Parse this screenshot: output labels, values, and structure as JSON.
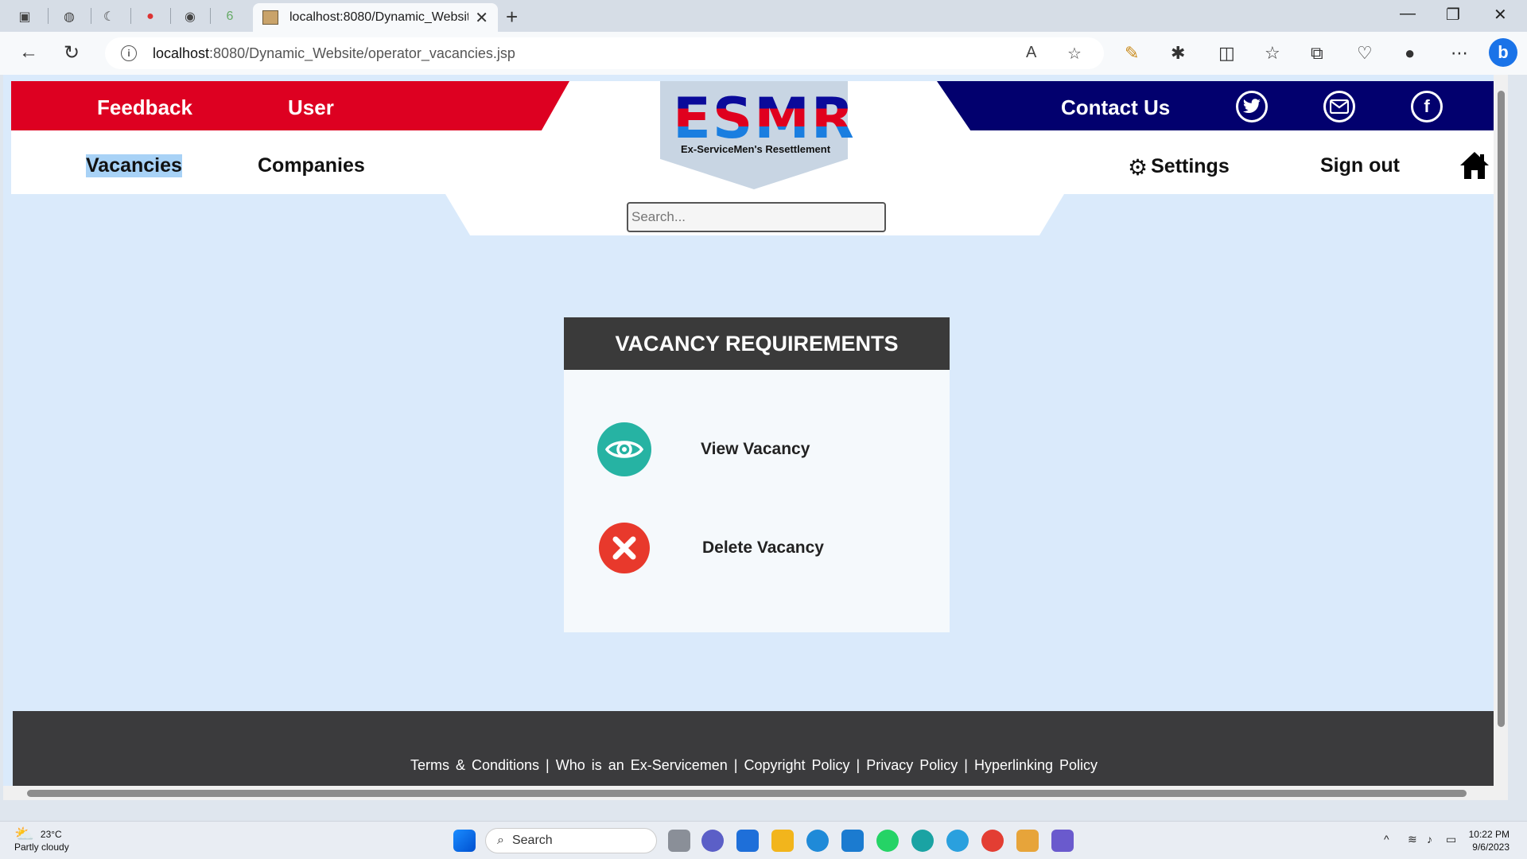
{
  "browser": {
    "tab_title": "localhost:8080/Dynamic_Website/operator_vacancies.jsp",
    "url_host": "localhost",
    "url_rest": ":8080/Dynamic_Website/operator_vacancies.jsp"
  },
  "header": {
    "red_links": [
      "Feedback",
      "User"
    ],
    "contact": "Contact Us",
    "social_icons": [
      "twitter-icon",
      "mail-icon",
      "facebook-icon"
    ],
    "logo_text": "ESMR",
    "logo_subtitle": "Ex-ServiceMen's Resettlement",
    "nav_left": [
      "Vacancies",
      "Companies"
    ],
    "settings": "Settings",
    "signout": "Sign out",
    "search_placeholder": "Search..."
  },
  "card": {
    "title": "VACANCY REQUIREMENTS",
    "actions": [
      {
        "label": "View Vacancy",
        "icon": "eye-icon",
        "color": "#26b3a3"
      },
      {
        "label": "Delete Vacancy",
        "icon": "delete-icon",
        "color": "#e8392c"
      }
    ]
  },
  "footer": {
    "links": [
      "Terms & Conditions",
      "Who is an Ex-Servicemen",
      "Copyright Policy",
      "Privacy Policy",
      "Hyperlinking Policy"
    ]
  },
  "taskbar": {
    "temp": "23°C",
    "weather": "Partly cloudy",
    "search": "Search",
    "time": "10:22 PM",
    "date": "9/6/2023"
  },
  "colors": {
    "red": "#dd0021",
    "navy": "#02006e",
    "page_bg": "#daeafb",
    "footer_bg": "#3b3b3d"
  }
}
